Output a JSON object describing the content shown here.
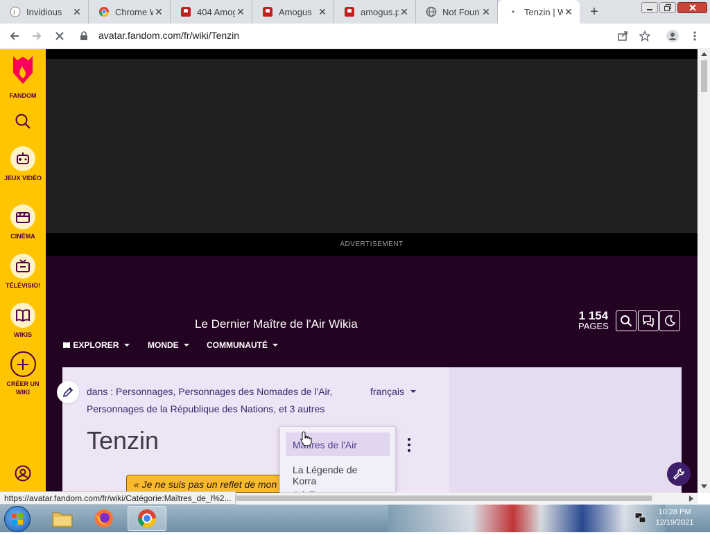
{
  "browser": {
    "tabs": [
      {
        "title": "Invidious",
        "icon": "invidious-icon"
      },
      {
        "title": "Chrome W",
        "icon": "chrome-icon"
      },
      {
        "title": "404 Amog",
        "icon": "amogus-icon"
      },
      {
        "title": "Amogus",
        "icon": "amogus-icon"
      },
      {
        "title": "amogus.p",
        "icon": "amogus-icon"
      },
      {
        "title": "Not Foun",
        "icon": "globe-icon"
      },
      {
        "title": "Tenzin | W",
        "icon": "loading-icon",
        "active": true
      }
    ],
    "close_glyph": "✕",
    "new_tab_glyph": "+",
    "url": "avatar.fandom.com/fr/wiki/Tenzin",
    "status_url": "https://avatar.fandom.com/fr/wiki/Catégorie:Maîtres_de_l%2..."
  },
  "rail": {
    "logo_label": "FANDOM",
    "items": [
      {
        "label": "JEUX VIDÉO",
        "icon": "gamepad-icon"
      },
      {
        "label": "CINÉMA",
        "icon": "clapperboard-icon"
      },
      {
        "label": "TÉLÉVISIO!",
        "icon": "tv-icon"
      },
      {
        "label": "WIKIS",
        "icon": "book-icon"
      },
      {
        "label": "CRÉER UN WIKI",
        "icon": "plus-icon"
      }
    ]
  },
  "ad": {
    "label": "ADVERTISEMENT"
  },
  "wiki": {
    "title": "Le Dernier Maître de l'Air Wikia",
    "nav": [
      "EXPLORER",
      "MONDE",
      "COMMUNAUTÉ"
    ],
    "page_count": "1 154",
    "page_count_label": "PAGES"
  },
  "article": {
    "categories_line1": "dans : Personnages, Personnages des Nomades de l'Air,",
    "categories_line2": "Personnages de la République des Nations, et 3 autres",
    "language": "français",
    "title": "Tenzin",
    "quote": "« Je ne suis pas un reflet de mon"
  },
  "dropdown": {
    "items": [
      "Maîtres de l'Air",
      "La Légende de Korra",
      "A à Z"
    ]
  },
  "taskbar": {
    "time": "10:28 PM",
    "date": "12/19/2021"
  },
  "colors": {
    "fandom_yellow": "#ffc500",
    "header_purple": "#230322",
    "quote_orange": "#f8ba2a"
  }
}
